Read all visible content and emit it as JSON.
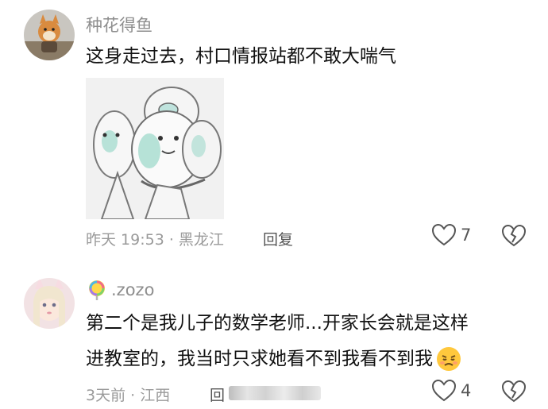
{
  "comments": [
    {
      "username": "种花得鱼",
      "text": "这身走过去，村口情报站都不敢大喘气",
      "meta": "昨天 19:53 · 黑龙江",
      "reply": "回复",
      "likes": "7"
    },
    {
      "username_icon": "lollipop-icon",
      "username": ".zozo",
      "text_line1": "第二个是我儿子的数学老师...开家长会就是这样",
      "text_line2": "进教室的，我当时只求她看不到我看不到我",
      "emoji": "pouting-face-emoji",
      "meta": "3天前 · 江西",
      "reply": "回",
      "likes": "4"
    }
  ]
}
